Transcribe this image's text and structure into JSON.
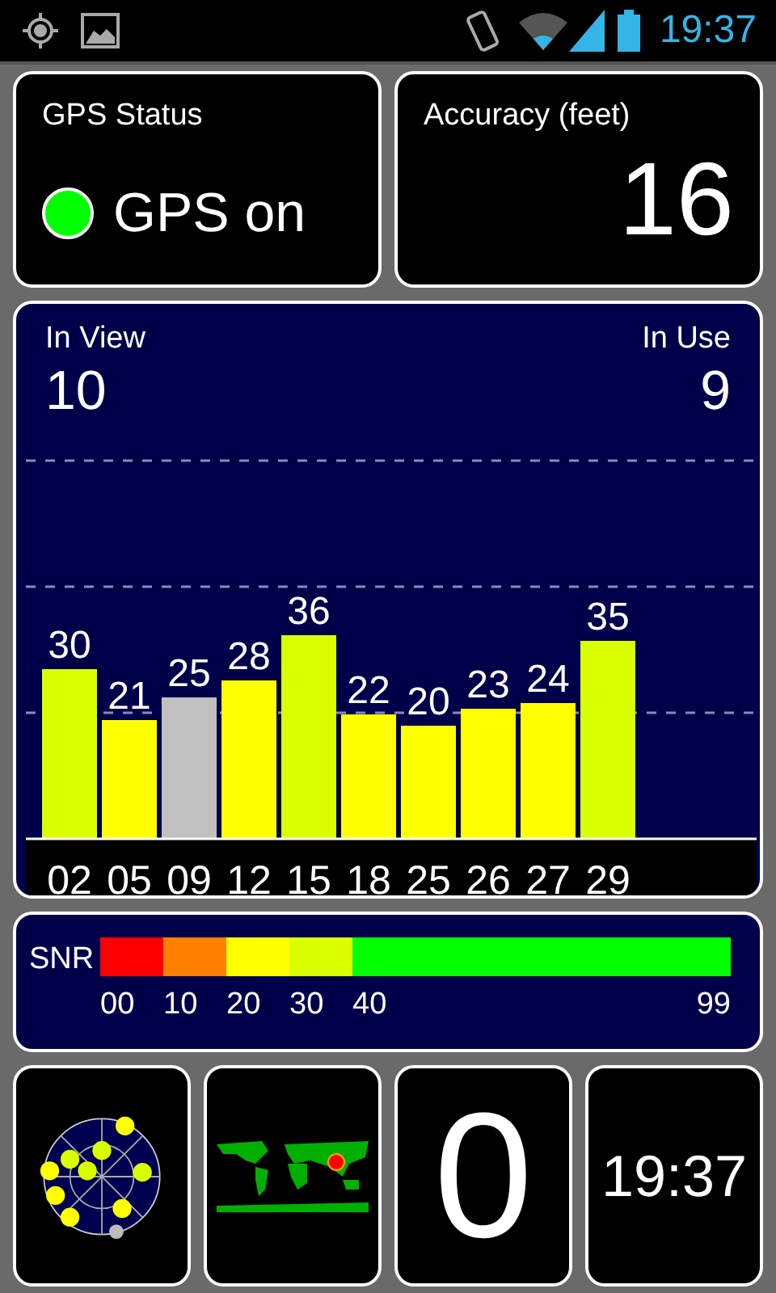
{
  "status_bar": {
    "time": "19:37"
  },
  "gps_status": {
    "title": "GPS Status",
    "text": "GPS on",
    "on": true
  },
  "accuracy": {
    "title": "Accuracy (feet)",
    "value": "16"
  },
  "satellites": {
    "in_view_label": "In View",
    "in_view": "10",
    "in_use_label": "In Use",
    "in_use": "9",
    "chart_data": {
      "type": "bar",
      "categories": [
        "02",
        "05",
        "09",
        "12",
        "15",
        "18",
        "25",
        "26",
        "27",
        "29"
      ],
      "values": [
        30,
        21,
        25,
        28,
        36,
        22,
        20,
        23,
        24,
        35
      ],
      "colors": [
        "#d9ff00",
        "#ffff00",
        "#c0c0c0",
        "#ffff00",
        "#d9ff00",
        "#ffff00",
        "#ffff00",
        "#ffff00",
        "#ffff00",
        "#d9ff00"
      ],
      "data_labels": true
    }
  },
  "snr_legend": {
    "label": "SNR",
    "segments": [
      {
        "label": "00",
        "color": "#ff0000"
      },
      {
        "label": "10",
        "color": "#ff8000"
      },
      {
        "label": "20",
        "color": "#ffff00"
      },
      {
        "label": "30",
        "color": "#d9ff00"
      },
      {
        "label": "40",
        "color": "#00ff00"
      }
    ],
    "end_label": "99"
  },
  "tiles": [
    {
      "kind": "radar"
    },
    {
      "kind": "map"
    },
    {
      "kind": "number",
      "text": "0"
    },
    {
      "kind": "clock",
      "text": "19:37"
    }
  ]
}
